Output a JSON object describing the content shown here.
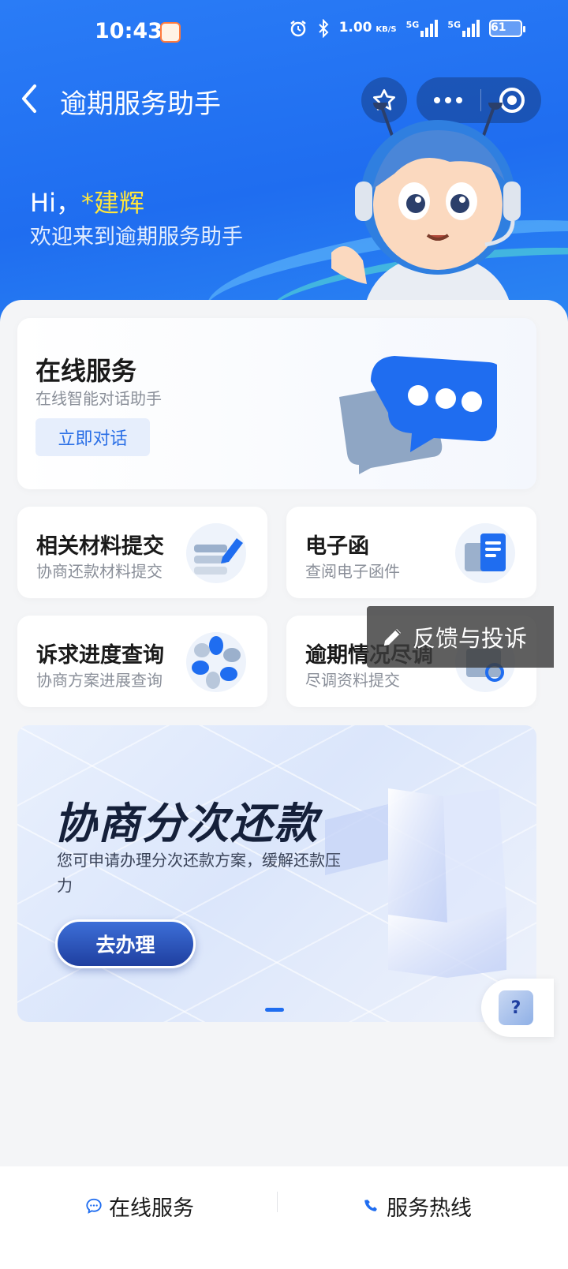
{
  "status_bar": {
    "time": "10:43",
    "net_speed_value": "1.00",
    "net_speed_unit": "KB/S",
    "signal1_label": "5G",
    "signal2_label": "5G",
    "battery": "61"
  },
  "nav": {
    "back_icon": "chevron-left-icon",
    "title": "逾期服务助手"
  },
  "hero": {
    "hi": "Hi，",
    "name": "*建辉",
    "welcome": "欢迎来到逾期服务助手"
  },
  "online_service": {
    "title": "在线服务",
    "subtitle": "在线智能对话助手",
    "button": "立即对话"
  },
  "services": [
    {
      "title": "相关材料提交",
      "subtitle": "协商还款材料提交"
    },
    {
      "title": "电子函",
      "subtitle": "查阅电子函件"
    },
    {
      "title": "诉求进度查询",
      "subtitle": "协商方案进展查询"
    },
    {
      "title": "逾期情况尽调",
      "subtitle": "尽调资料提交"
    }
  ],
  "feedback": {
    "label": "反馈与投诉"
  },
  "banner": {
    "title": "协商分次还款",
    "desc": "您可申请办理分次还款方案，缓解还款压力",
    "button": "去办理"
  },
  "help": {
    "label": "?"
  },
  "bottom_bar": {
    "online": "在线服务",
    "hotline": "服务热线"
  },
  "colors": {
    "brand": "#1f6df0",
    "name_highlight": "#ffe63c",
    "link": "#2a6fe6"
  }
}
